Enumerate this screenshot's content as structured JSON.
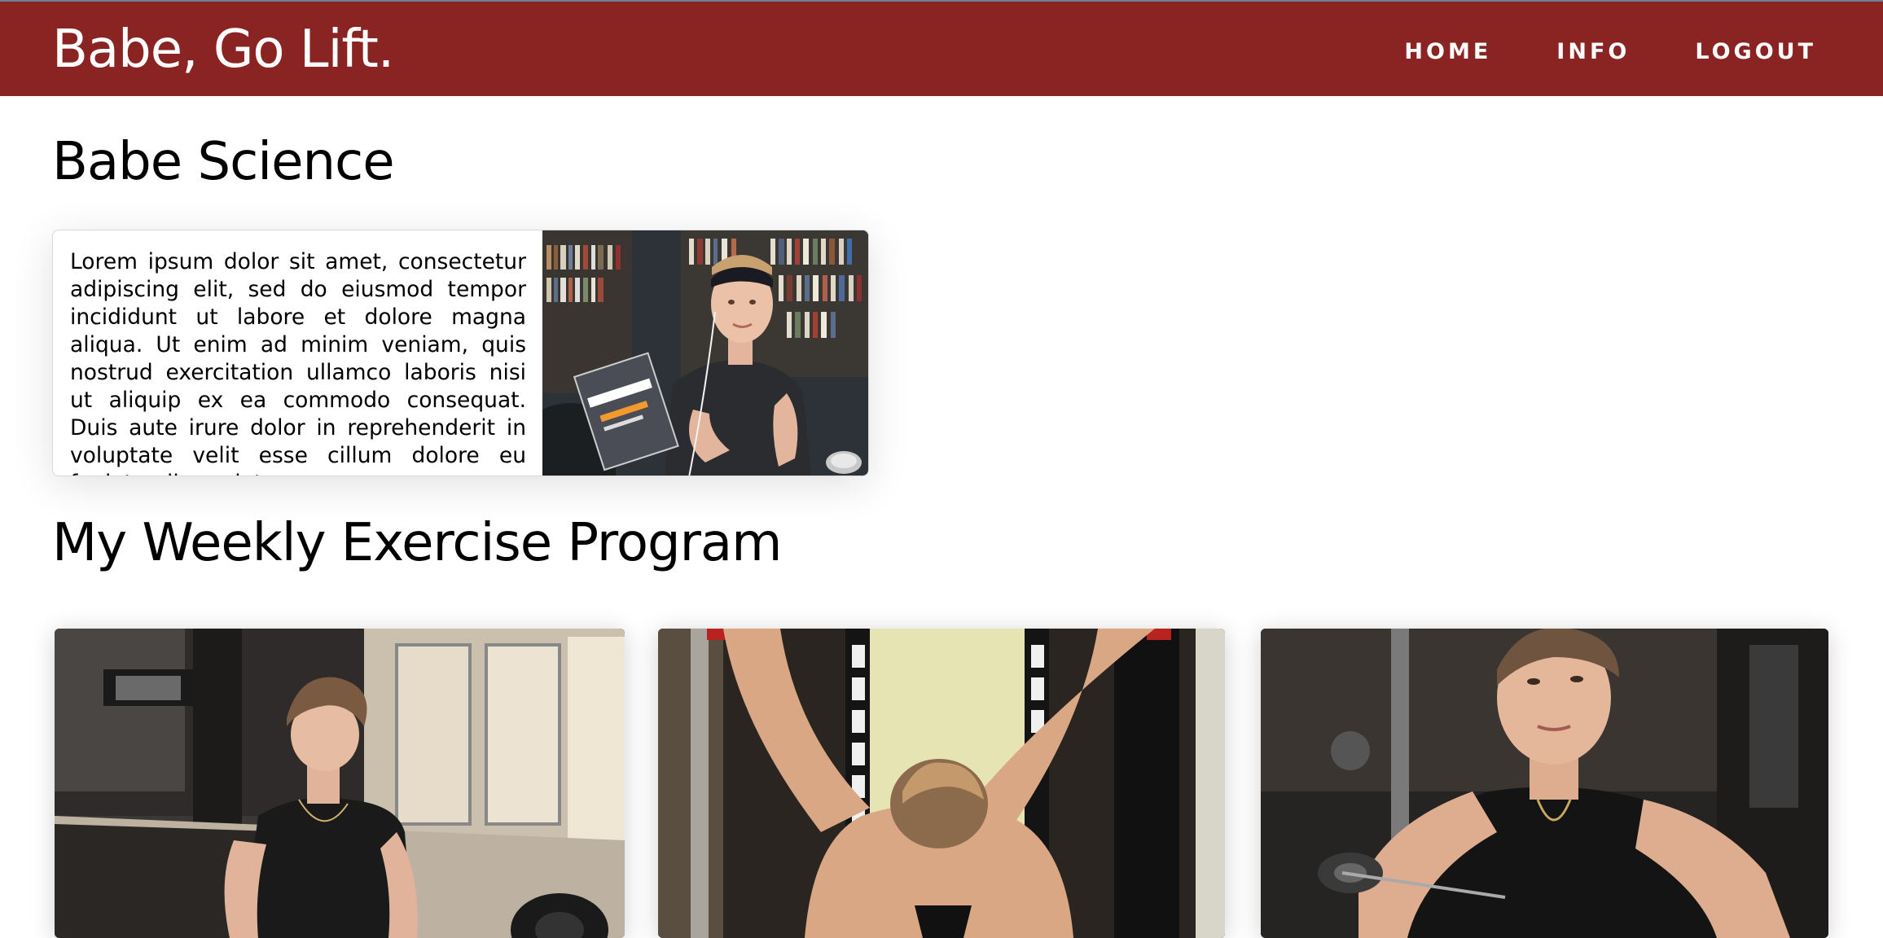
{
  "navbar": {
    "brand": "Babe, Go Lift.",
    "links": [
      "HOME",
      "INFO",
      "LOGOUT"
    ]
  },
  "science": {
    "title": "Babe Science",
    "body": "Lorem ipsum dolor sit amet, consectetur adipiscing elit, sed do eiusmod tempor incididunt ut labore et dolore magna aliqua. Ut enim ad minim veniam, quis nostrud exercitation ullamco laboris nisi ut aliquip ex ea commodo consequat. Duis aute irure dolor in reprehenderit in voluptate velit esse cillum dolore eu fugiat nulla pariatur.",
    "photo": "woman-reading-book-photo"
  },
  "program": {
    "title": "My Weekly Exercise Program",
    "cards": [
      {
        "photo": "deadlift-photo"
      },
      {
        "photo": "pulldown-photo"
      },
      {
        "photo": "cable-press-photo"
      }
    ]
  },
  "colors": {
    "navbar": "#8a2423",
    "nav_text": "#ffffff"
  }
}
